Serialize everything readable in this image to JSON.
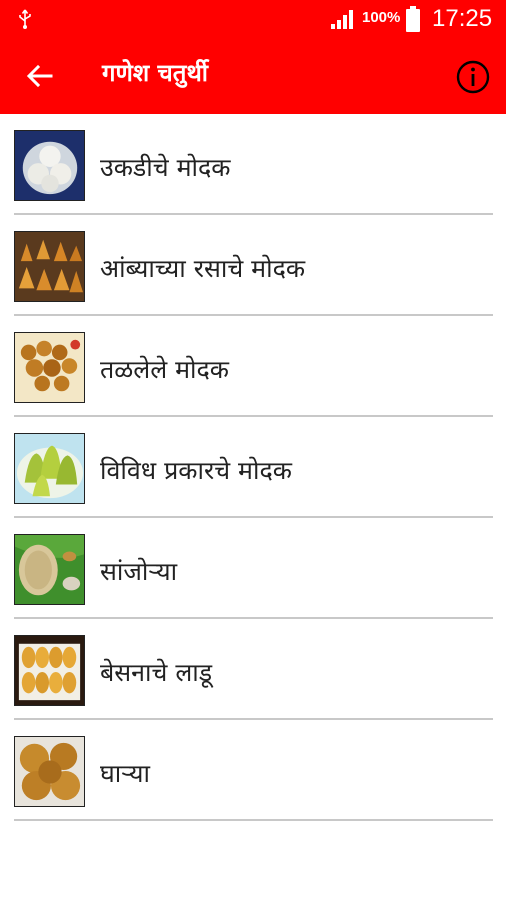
{
  "status_bar": {
    "battery": "100%",
    "time": "17:25"
  },
  "app_bar": {
    "title": "गणेश चतुर्थी",
    "back_icon": "arrow-left-icon",
    "info_icon": "info-circle-icon"
  },
  "colors": {
    "brand": "#ff0000",
    "divider": "#c8c8c8"
  },
  "items": [
    {
      "label": "उकडीचे मोदक",
      "thumb": "modak-steamed-thumbnail"
    },
    {
      "label": "आंब्याच्या रसाचे मोदक",
      "thumb": "mango-modak-thumbnail"
    },
    {
      "label": "तळलेले मोदक",
      "thumb": "fried-modak-thumbnail"
    },
    {
      "label": "विविध प्रकारचे मोदक",
      "thumb": "assorted-modak-thumbnail"
    },
    {
      "label": "सांजोऱ्या",
      "thumb": "sanjorya-thumbnail"
    },
    {
      "label": "बेसनाचे लाडू",
      "thumb": "besan-ladoo-thumbnail"
    },
    {
      "label": "घाऱ्या",
      "thumb": "gharya-thumbnail"
    }
  ]
}
